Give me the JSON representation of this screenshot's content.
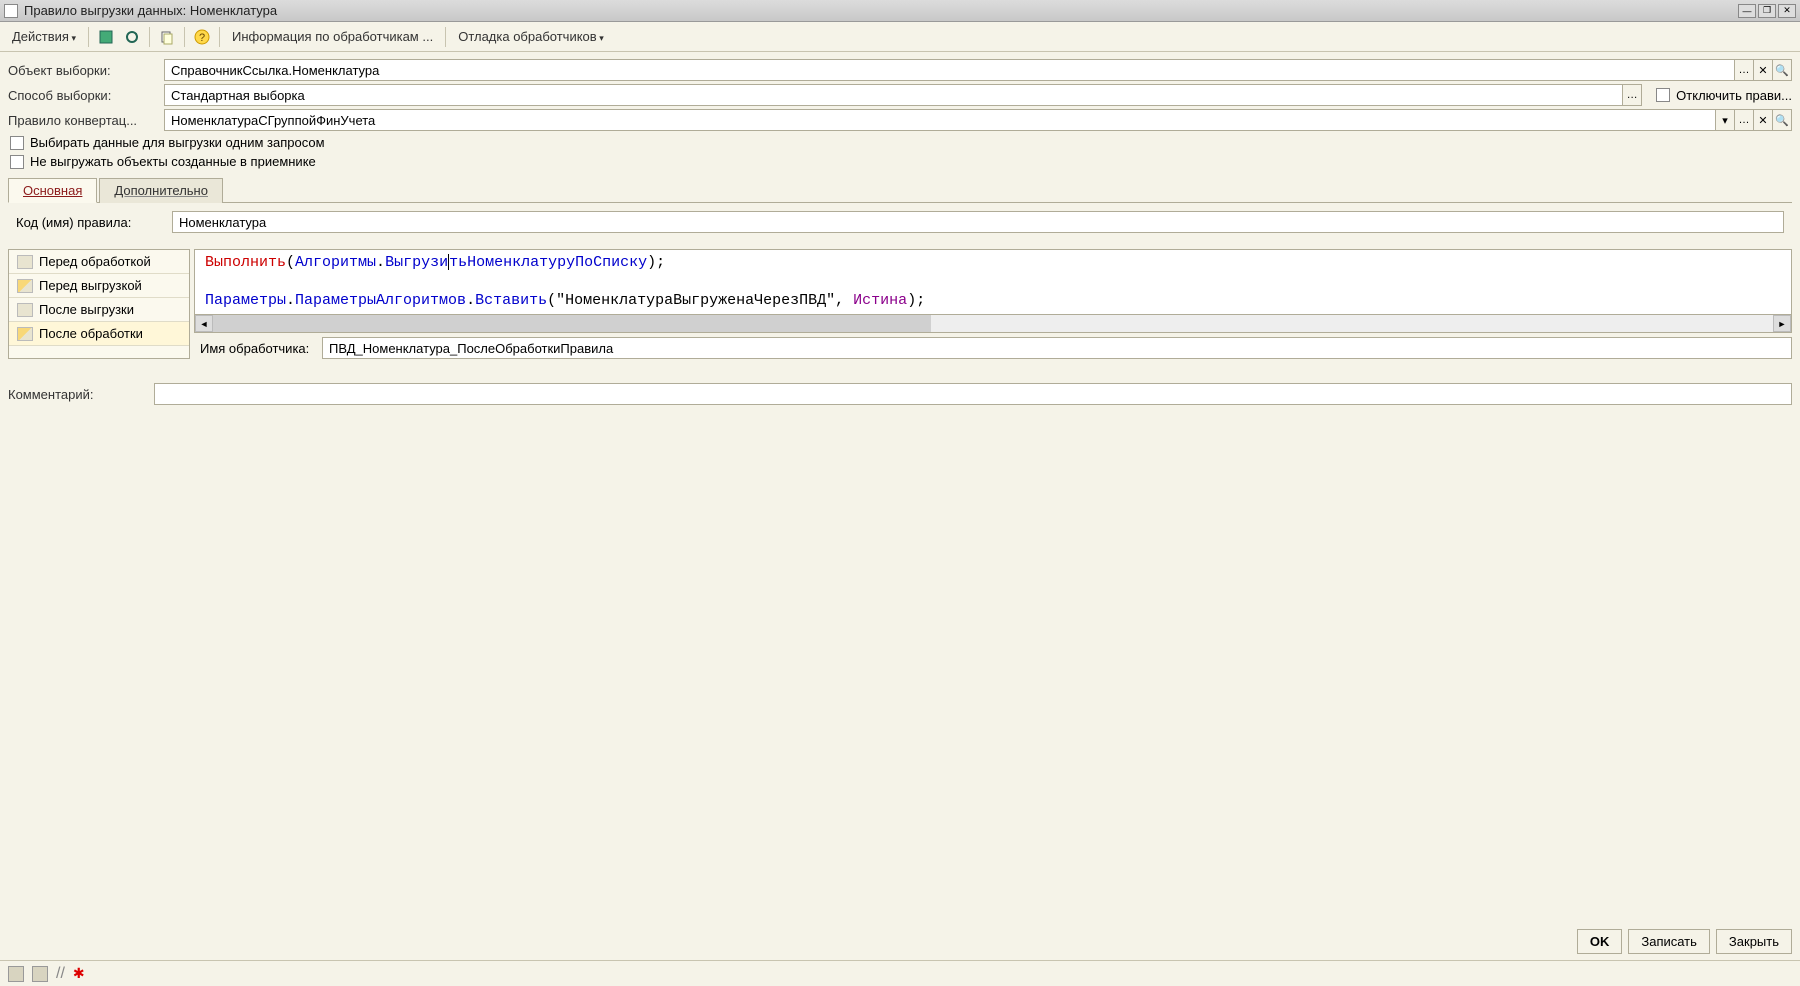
{
  "window": {
    "title": "Правило выгрузки данных: Номенклатура"
  },
  "toolbar": {
    "actions": "Действия",
    "info": "Информация по обработчикам ...",
    "debug": "Отладка обработчиков"
  },
  "fields": {
    "object_label": "Объект выборки:",
    "object_value": "СправочникСсылка.Номенклатура",
    "method_label": "Способ выборки:",
    "method_value": "Стандартная выборка",
    "rule_label": "Правило конвертац...",
    "rule_value": "НоменклатураСГруппойФинУчета",
    "disable_label": "Отключить прави...",
    "chk1": "Выбирать данные для выгрузки одним запросом",
    "chk2": "Не выгружать объекты созданные в приемнике"
  },
  "tabs": {
    "main": "Основная",
    "extra": "Дополнительно"
  },
  "rule_code": {
    "label": "Код (имя) правила:",
    "value": "Номенклатура"
  },
  "sidebar": {
    "items": [
      {
        "label": "Перед обработкой",
        "has_code": false
      },
      {
        "label": "Перед выгрузкой",
        "has_code": true
      },
      {
        "label": "После выгрузки",
        "has_code": false
      },
      {
        "label": "После обработки",
        "has_code": true,
        "selected": true
      }
    ]
  },
  "code": {
    "line1_kw": "Выполнить",
    "line1_p1": "(",
    "line1_obj": "Алгоритмы",
    "line1_dot": ".",
    "line1_m1": "Выгрузи",
    "line1_m2": "тьНоменклатуруПоСписку",
    "line1_p2": ");",
    "line3_obj": "Параметры",
    "line3_dot1": ".",
    "line3_m1": "ПараметрыАлгоритмов",
    "line3_dot2": ".",
    "line3_m2": "Вставить",
    "line3_p1": "(",
    "line3_str": "\"НоменклатураВыгруженаЧерезПВД\"",
    "line3_comma": ", ",
    "line3_val": "Истина",
    "line3_p2": ");"
  },
  "handler": {
    "label": "Имя обработчика:",
    "value": "ПВД_Номенклатура_ПослеОбработкиПравила"
  },
  "comment": {
    "label": "Комментарий:",
    "value": ""
  },
  "footer": {
    "ok": "OK",
    "save": "Записать",
    "close": "Закрыть"
  }
}
